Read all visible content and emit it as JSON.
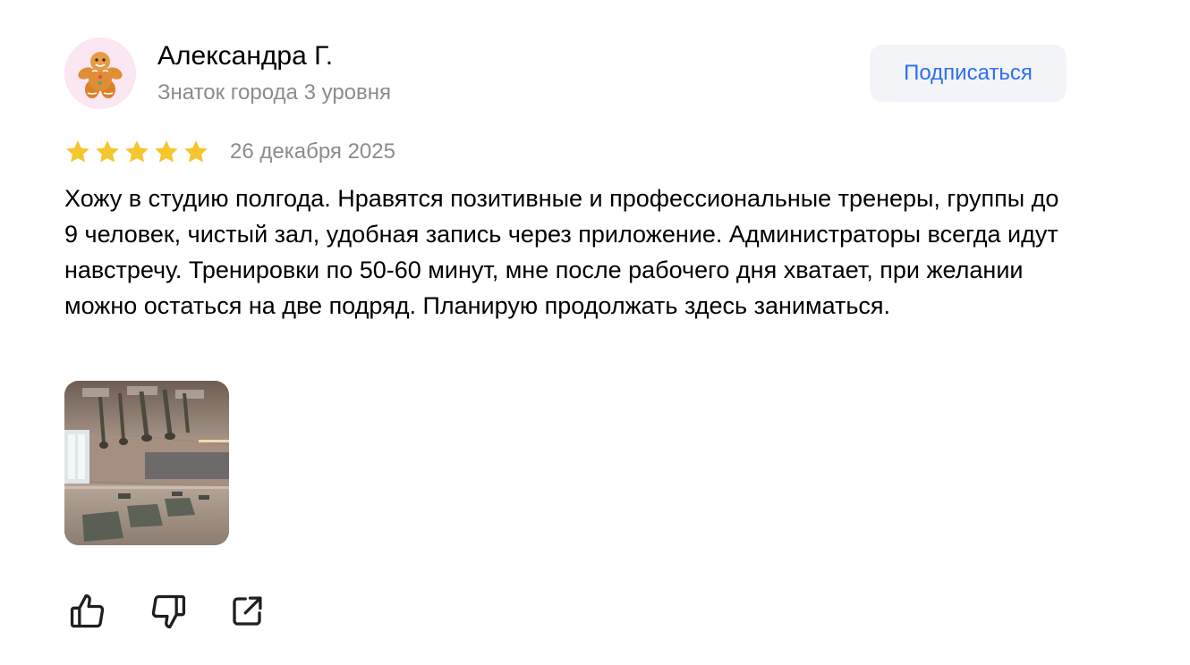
{
  "author": {
    "name": "Александра Г.",
    "level": "Знаток города 3 уровня",
    "avatar_icon": "gingerbread-man-icon"
  },
  "subscribe_label": "Подписаться",
  "rating": {
    "value": 5,
    "max": 5
  },
  "date": "26 декабря 2025",
  "text": "Хожу в студию полгода. Нравятся позитивные и профессиональные тренеры, группы до 9 человек, чистый зал, удобная запись через приложение. Администраторы всегда идут навстречу. Тренировки по 50-60 минут, мне после рабочего дня хватает, при желании можно остаться на две подряд. Планирую продолжать здесь заниматься.",
  "actions": {
    "like_icon": "thumbs-up-icon",
    "dislike_icon": "thumbs-down-icon",
    "share_icon": "share-icon"
  },
  "colors": {
    "star": "#f7c52c",
    "accent": "#2f6ef0",
    "secondary_text": "#8c8c8c",
    "button_bg": "#f3f4f7"
  }
}
